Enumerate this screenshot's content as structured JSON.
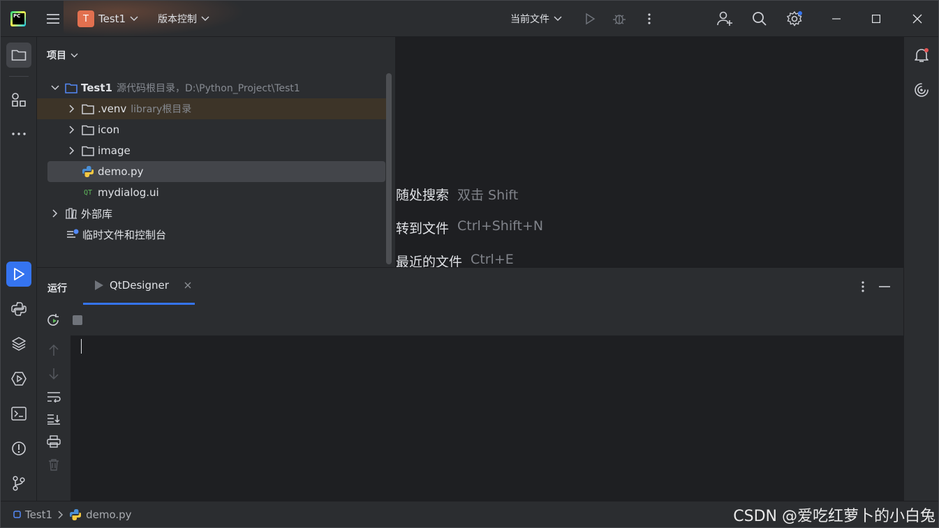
{
  "titlebar": {
    "project_badge": "T",
    "project_name": "Test1",
    "vcs_label": "版本控制",
    "run_config": "当前文件"
  },
  "project_panel": {
    "header": "项目",
    "tree": [
      {
        "name": "Test1",
        "hint": "源代码根目录，D:\\Python_Project\\Test1",
        "kind": "folder-root"
      },
      {
        "name": ".venv",
        "hint": "library根目录",
        "kind": "folder"
      },
      {
        "name": "icon",
        "hint": "",
        "kind": "folder"
      },
      {
        "name": "image",
        "hint": "",
        "kind": "folder"
      },
      {
        "name": "demo.py",
        "hint": "",
        "kind": "python-file"
      },
      {
        "name": "mydialog.ui",
        "hint": "",
        "kind": "qt-file"
      },
      {
        "name": "外部库",
        "hint": "",
        "kind": "library"
      },
      {
        "name": "临时文件和控制台",
        "hint": "",
        "kind": "scratch"
      }
    ]
  },
  "editor_hints": [
    {
      "label": "随处搜索",
      "keys": "双击 Shift"
    },
    {
      "label": "转到文件",
      "keys": "Ctrl+Shift+N"
    },
    {
      "label": "最近的文件",
      "keys": "Ctrl+E"
    }
  ],
  "run_panel": {
    "title": "运行",
    "tab_label": "QtDesigner"
  },
  "statusbar": {
    "project": "Test1",
    "file": "demo.py",
    "watermark": "CSDN @爱吃红萝卜的小白兔"
  },
  "colors": {
    "accent": "#3574f0",
    "badge": "#e2704f",
    "panel_bg": "#2b2d30",
    "editor_bg": "#1e1f22"
  }
}
